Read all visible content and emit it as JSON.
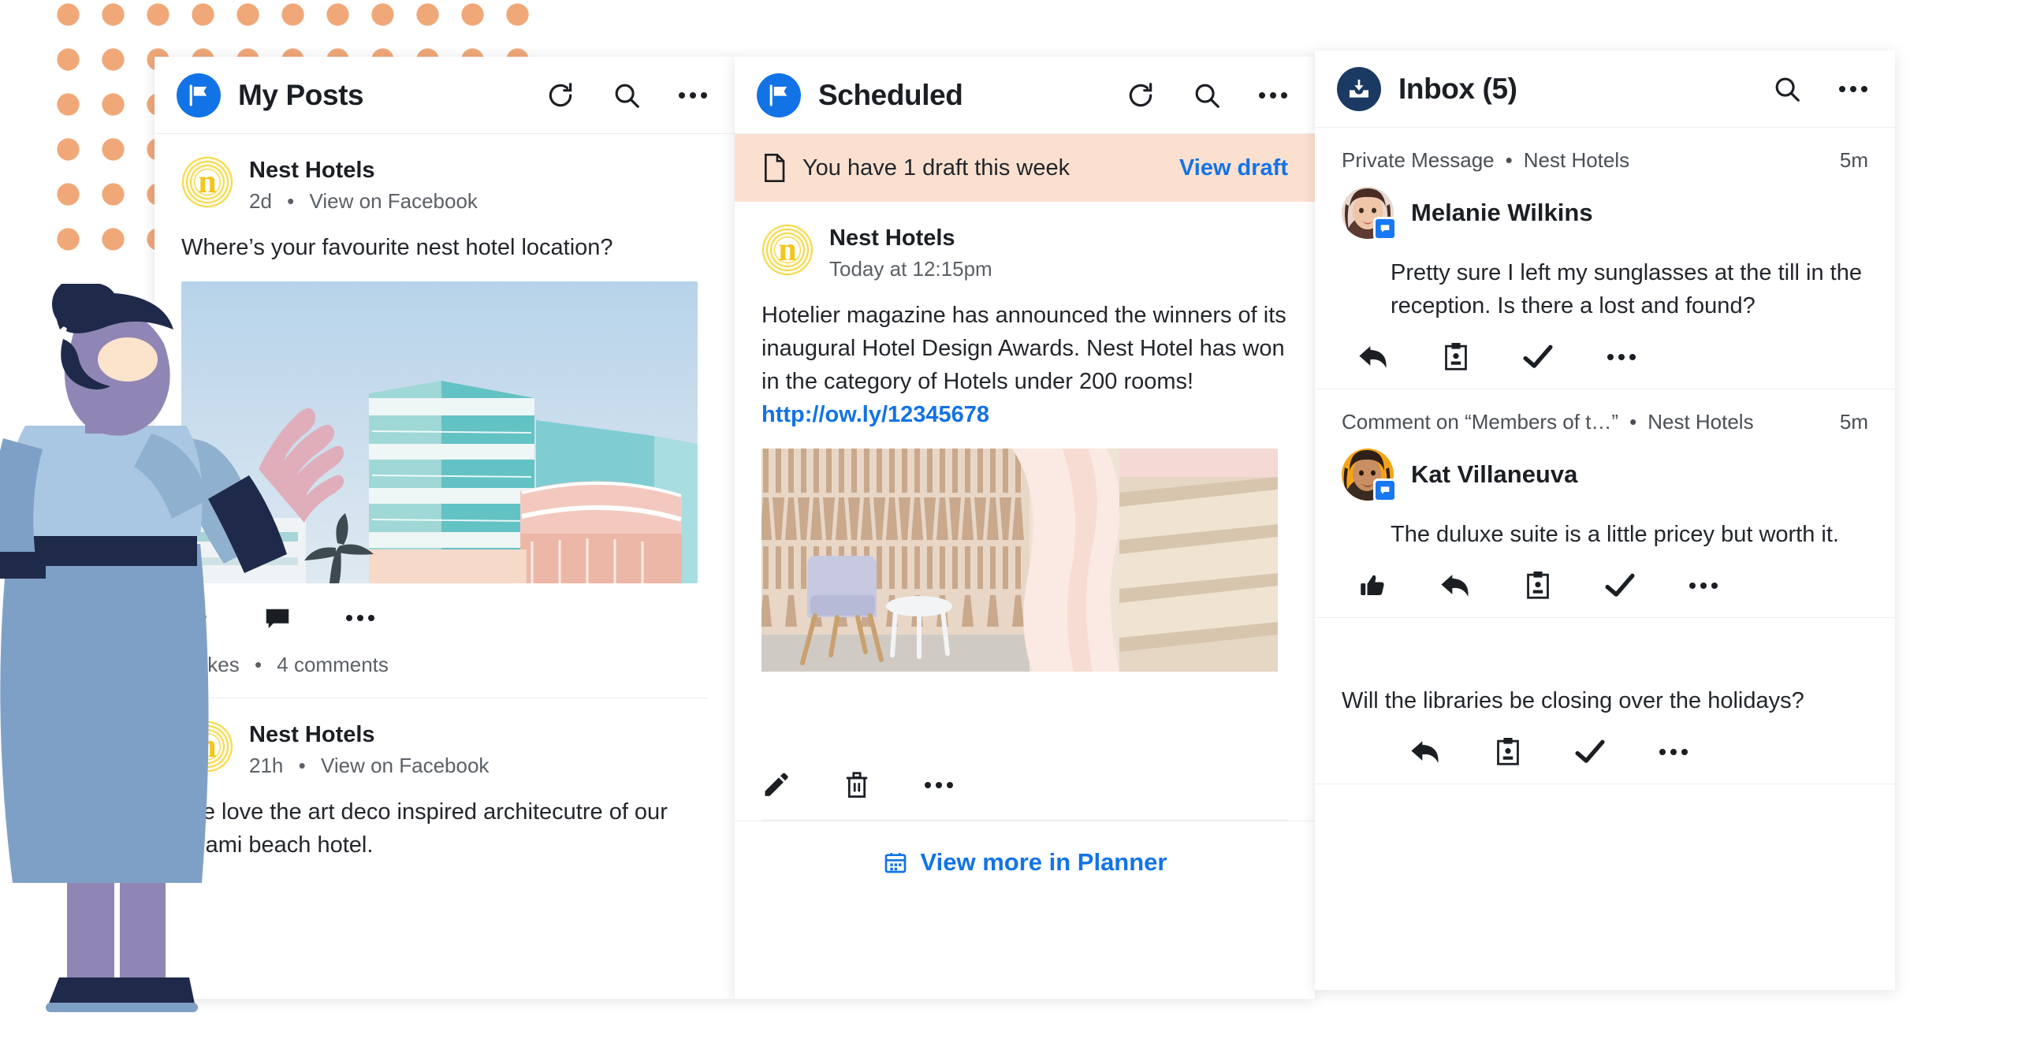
{
  "decor": {
    "dot_color": "#f0a878",
    "illustration_name": "woman-standing-illustration"
  },
  "colors": {
    "accent_blue": "#1273e6",
    "badge_navy": "#1b3a63",
    "banner_peach": "#fbe0d0",
    "brand_gold": "#f2c61c"
  },
  "columns": {
    "posts": {
      "title": "My Posts",
      "icon": "flag-icon",
      "actions": [
        "refresh-icon",
        "search-icon",
        "more-icon"
      ],
      "items": [
        {
          "author": "Nest Hotels",
          "time": "2d",
          "source_label": "View on Facebook",
          "body": "Where’s your favourite nest hotel location?",
          "has_photo": true,
          "photo_name": "miami-art-deco-hotel-photo",
          "actions": [
            "like-icon",
            "comment-icon",
            "more-icon"
          ],
          "stats_likes": "2 likes",
          "stats_comments": "4 comments"
        },
        {
          "author": "Nest Hotels",
          "time": "21h",
          "source_label": "View on Facebook",
          "body": "We love the art deco inspired architecutre of our Miami beach hotel.",
          "has_photo": false
        }
      ]
    },
    "scheduled": {
      "title": "Scheduled",
      "icon": "flag-icon",
      "actions": [
        "refresh-icon",
        "search-icon",
        "more-icon"
      ],
      "draft_banner": {
        "icon": "document-icon",
        "text": "You have 1 draft this week",
        "link": "View draft"
      },
      "item": {
        "author": "Nest Hotels",
        "time": "Today at 12:15pm",
        "body_text": "Hotelier magazine has announced the winners of its inaugural Hotel Design Awards. Nest Hotel has won in the category of Hotels under 200 rooms! ",
        "body_link": "http://ow.ly/12345678",
        "photo_name": "hotel-lobby-chair-photo",
        "actions": [
          "edit-icon",
          "delete-icon",
          "more-icon"
        ]
      },
      "footer": {
        "icon": "calendar-icon",
        "link": "View more in Planner"
      }
    },
    "inbox": {
      "title": "Inbox (5)",
      "icon": "inbox-icon",
      "actions": [
        "search-icon",
        "more-icon"
      ],
      "items": [
        {
          "type": "Private Message",
          "account": "Nest Hotels",
          "time": "5m",
          "name": "Melanie Wilkins",
          "avatar_name": "melanie-wilkins-avatar",
          "message": "Pretty sure I left my sunglasses at the till in the reception. Is there a lost and found?",
          "actions": [
            "reply-icon",
            "assign-icon",
            "resolve-icon",
            "more-icon"
          ]
        },
        {
          "type": "Comment on “Members of t…”",
          "account": "Nest Hotels",
          "time": "5m",
          "name": "Kat Villaneuva",
          "avatar_name": "kat-villaneuva-avatar",
          "message": "The duluxe suite is a little pricey but worth it.",
          "actions": [
            "like-icon",
            "reply-icon",
            "assign-icon",
            "resolve-icon",
            "more-icon"
          ]
        },
        {
          "type": "",
          "account": "",
          "time": "",
          "name": "",
          "message": "Will the libraries be closing over the holidays?",
          "actions": [
            "reply-icon",
            "assign-icon",
            "resolve-icon",
            "more-icon"
          ]
        }
      ]
    }
  }
}
